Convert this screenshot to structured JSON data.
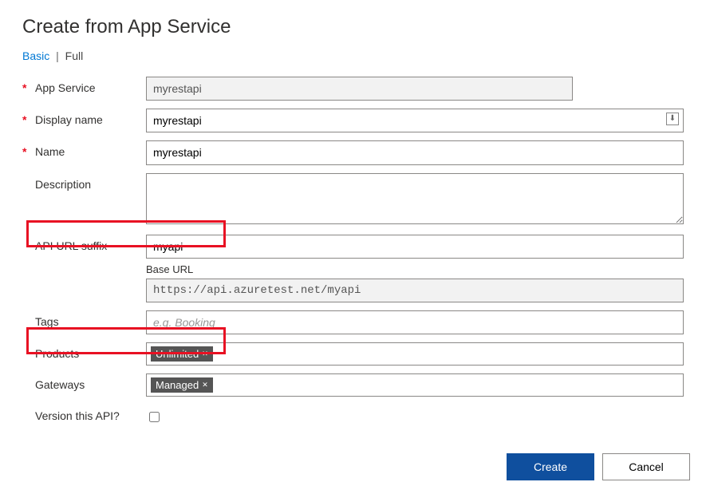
{
  "title": "Create from App Service",
  "tabs": {
    "basic": "Basic",
    "full": "Full",
    "separator": "|"
  },
  "form": {
    "app_service": {
      "label": "App Service",
      "value": "myrestapi",
      "required": true
    },
    "display_name": {
      "label": "Display name",
      "value": "myrestapi",
      "required": true
    },
    "name": {
      "label": "Name",
      "value": "myrestapi",
      "required": true
    },
    "description": {
      "label": "Description",
      "value": ""
    },
    "api_url_suffix": {
      "label": "API URL suffix",
      "value": "myapi"
    },
    "base_url": {
      "label": "Base URL",
      "value": "https://api.azuretest.net/myapi"
    },
    "tags": {
      "label": "Tags",
      "placeholder": "e.g. Booking"
    },
    "products": {
      "label": "Products",
      "chip": "Unlimited"
    },
    "gateways": {
      "label": "Gateways",
      "chip": "Managed"
    },
    "version": {
      "label": "Version this API?",
      "checked": false
    }
  },
  "buttons": {
    "create": "Create",
    "cancel": "Cancel"
  },
  "icons": {
    "chip_remove": "✕"
  }
}
